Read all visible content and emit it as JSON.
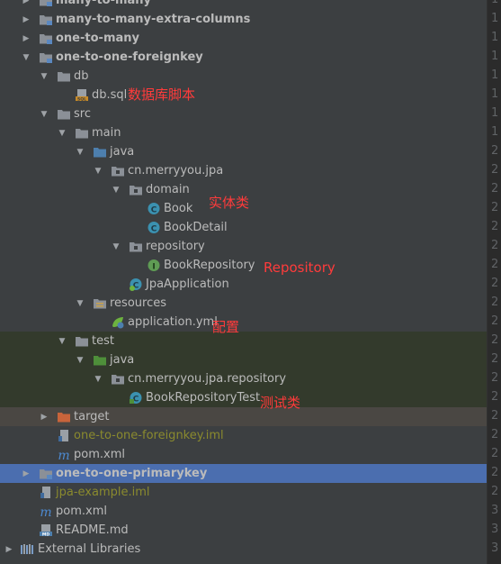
{
  "tree": [
    {
      "label": "many-to-many",
      "bold": true,
      "arrow": "right",
      "indent": 0,
      "icon": "module-folder-icon"
    },
    {
      "label": "many-to-many-extra-columns",
      "bold": true,
      "arrow": "right",
      "indent": 0,
      "icon": "module-folder-icon"
    },
    {
      "label": "one-to-many",
      "bold": true,
      "arrow": "right",
      "indent": 0,
      "icon": "module-folder-icon"
    },
    {
      "label": "one-to-one-foreignkey",
      "bold": true,
      "arrow": "down",
      "indent": 0,
      "icon": "module-folder-icon"
    },
    {
      "label": "db",
      "arrow": "down",
      "indent": 1,
      "icon": "folder-icon"
    },
    {
      "label": "db.sql",
      "arrow": "",
      "indent": 2,
      "icon": "sql-file-icon"
    },
    {
      "label": "src",
      "arrow": "down",
      "indent": 1,
      "icon": "folder-icon"
    },
    {
      "label": "main",
      "arrow": "down",
      "indent": 2,
      "icon": "folder-icon"
    },
    {
      "label": "java",
      "arrow": "down",
      "indent": 3,
      "icon": "source-folder-icon"
    },
    {
      "label": "cn.merryyou.jpa",
      "arrow": "down",
      "indent": 4,
      "icon": "package-icon"
    },
    {
      "label": "domain",
      "arrow": "down",
      "indent": 5,
      "icon": "package-icon"
    },
    {
      "label": "Book",
      "arrow": "",
      "indent": 6,
      "icon": "class-icon"
    },
    {
      "label": "BookDetail",
      "arrow": "",
      "indent": 6,
      "icon": "class-icon"
    },
    {
      "label": "repository",
      "arrow": "down",
      "indent": 5,
      "icon": "package-icon"
    },
    {
      "label": "BookRepository",
      "arrow": "",
      "indent": 6,
      "icon": "interface-icon"
    },
    {
      "label": "JpaApplication",
      "arrow": "",
      "indent": 5,
      "icon": "spring-class-icon"
    },
    {
      "label": "resources",
      "arrow": "down",
      "indent": 3,
      "icon": "resources-folder-icon"
    },
    {
      "label": "application.yml",
      "arrow": "",
      "indent": 4,
      "icon": "spring-config-icon"
    },
    {
      "label": "test",
      "arrow": "down",
      "indent": 2,
      "icon": "folder-icon",
      "row": "test"
    },
    {
      "label": "java",
      "arrow": "down",
      "indent": 3,
      "icon": "test-source-folder-icon",
      "row": "test"
    },
    {
      "label": "cn.merryyou.jpa.repository",
      "arrow": "down",
      "indent": 4,
      "icon": "package-icon",
      "row": "test"
    },
    {
      "label": "BookRepositoryTest",
      "arrow": "",
      "indent": 5,
      "icon": "test-class-icon",
      "row": "test"
    },
    {
      "label": "target",
      "arrow": "right",
      "indent": 1,
      "icon": "excluded-folder-icon",
      "row": "excluded"
    },
    {
      "label": "one-to-one-foreignkey.iml",
      "arrow": "",
      "indent": 1,
      "icon": "iml-file-icon",
      "iml": true
    },
    {
      "label": "pom.xml",
      "arrow": "",
      "indent": 1,
      "icon": "maven-icon"
    },
    {
      "label": "one-to-one-primarykey",
      "bold": true,
      "arrow": "right",
      "indent": 0,
      "icon": "module-folder-icon",
      "row": "selected"
    },
    {
      "label": "jpa-example.iml",
      "arrow": "",
      "indent": 0,
      "icon": "iml-file-icon",
      "iml": true
    },
    {
      "label": "pom.xml",
      "arrow": "",
      "indent": 0,
      "icon": "maven-icon"
    },
    {
      "label": "README.md",
      "arrow": "",
      "indent": 0,
      "icon": "markdown-icon"
    },
    {
      "label": "External Libraries",
      "arrow": "right",
      "indent": -1,
      "icon": "libraries-icon"
    }
  ],
  "annotations": {
    "db_script": "数据库脚本",
    "entity": "实体类",
    "repository": "Repository",
    "config": "配置",
    "test": "测试类"
  },
  "gutter_digits": [
    "1",
    "1",
    "1",
    "1",
    "1",
    "1",
    "1",
    "1",
    "2",
    "2",
    "2",
    "2",
    "2",
    "2",
    "2",
    "2",
    "2",
    "2",
    "2",
    "2",
    "2",
    "2",
    "2",
    "2",
    "2",
    "2",
    "2",
    "3",
    "3",
    "3"
  ],
  "colors": {
    "panel": "#3c3f41",
    "selected": "#4b6eaf",
    "test_bg": "#333a2c",
    "excluded_bg": "#4a4743",
    "annotation": "#ff3b3b",
    "iml_text": "#8a8a2e"
  }
}
